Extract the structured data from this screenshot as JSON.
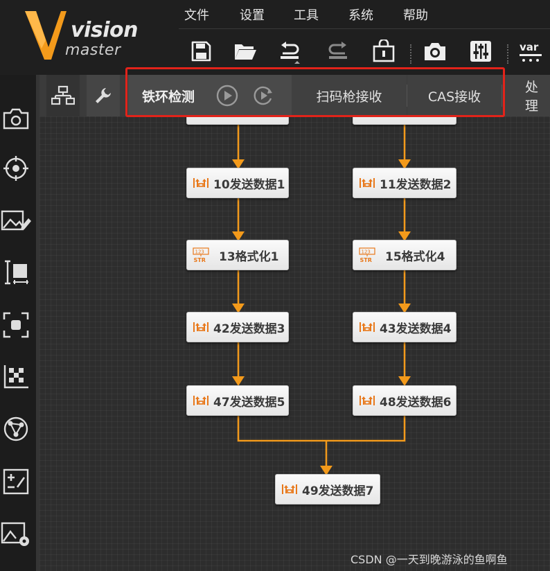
{
  "app": {
    "logo_word1": "vision",
    "logo_word2": "master",
    "accent_color": "#f39a1b",
    "highlight_color": "#e2231a"
  },
  "menu": {
    "file": "文件",
    "settings": "设置",
    "tools": "工具",
    "system": "系统",
    "help": "帮助"
  },
  "toolbar": {
    "items": [
      "save-icon",
      "open-folder-icon",
      "undo-icon",
      "redo-icon",
      "lock-icon",
      "camera-icon",
      "controls-icon",
      "variable-icon"
    ],
    "var_label": "var"
  },
  "leftbar": {
    "items": [
      "camera-icon",
      "target-icon",
      "image-edit-icon",
      "measure-icon",
      "focus-icon",
      "calibration-icon",
      "network-icon",
      "calculator-icon",
      "image-settings-icon"
    ]
  },
  "tabs": {
    "active": "铁环检测",
    "items": [
      "扫码枪接收",
      "CAS接收",
      "处理"
    ]
  },
  "flow": {
    "left_top_partial": "",
    "right_top_partial": "",
    "nodes": {
      "n10": "10发送数据1",
      "n11": "11发送数据2",
      "n13": "13格式化1",
      "n15": "15格式化4",
      "n42": "42发送数据3",
      "n43": "43发送数据4",
      "n47": "47发送数据5",
      "n48": "48发送数据6",
      "n49": "49发送数据7"
    },
    "format_icon_text_top": "123",
    "format_icon_text_bottom": "STR"
  },
  "watermark": "CSDN @一天到晚游泳的鱼啊鱼"
}
